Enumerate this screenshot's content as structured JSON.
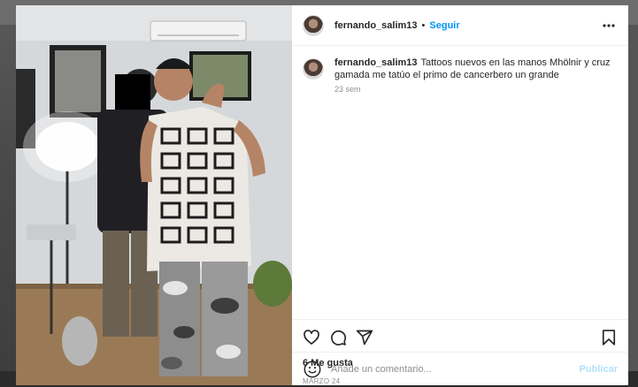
{
  "post": {
    "username": "fernando_salim13",
    "follow_label": "Seguir",
    "separator": "•",
    "caption": {
      "username": "fernando_salim13",
      "text": "Tattoos nuevos en las manos Mhölnir y cruz gamada me tatúo el primo de cancerbero un grande",
      "time": "23 sem"
    },
    "likes": "6 Me gusta",
    "date": "MARZO 24",
    "comment": {
      "placeholder": "Añade un comentario...",
      "post_label": "Publicar"
    }
  },
  "icons": {
    "more": "more-horizontal-icon",
    "like": "heart-icon",
    "comment": "comment-bubble-icon",
    "share": "paper-plane-icon",
    "save": "bookmark-icon",
    "emoji": "emoji-icon"
  },
  "colors": {
    "accent": "#0095f6",
    "post_disabled": "#b2dffc",
    "text": "#262626",
    "muted": "#8e8e8e"
  }
}
